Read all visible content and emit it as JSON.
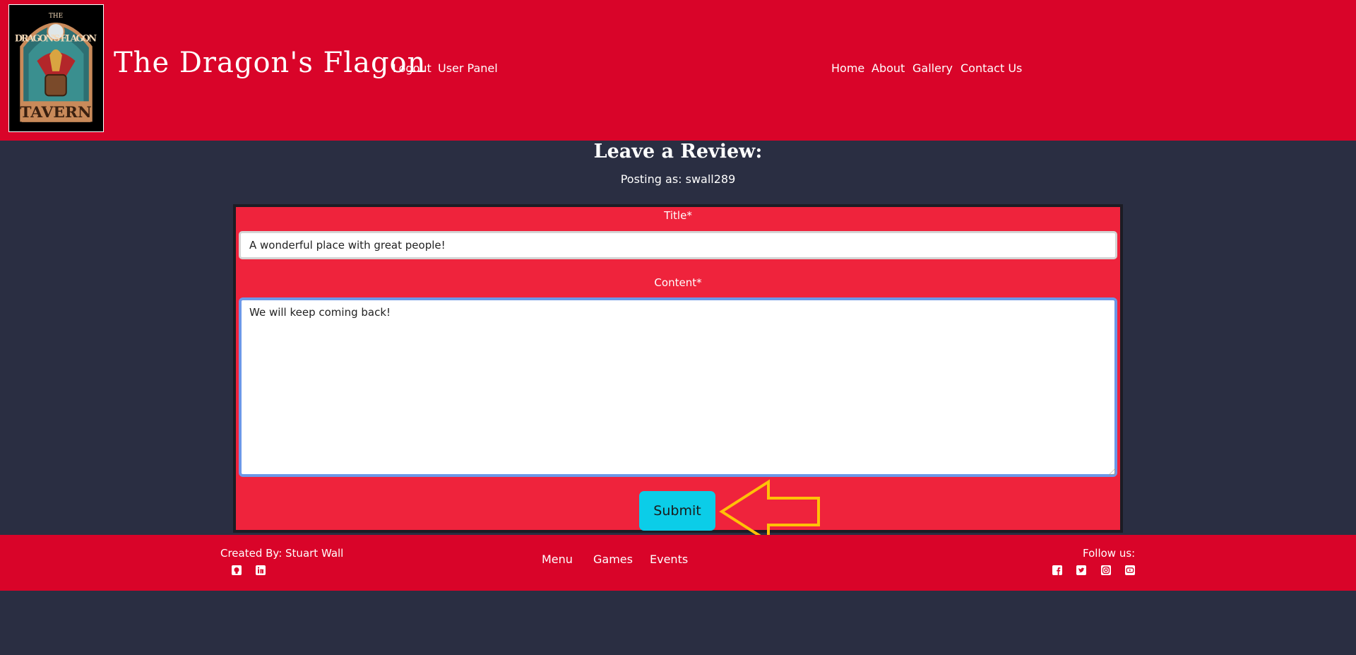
{
  "header": {
    "site_title": "The Dragon's Flagon",
    "logo": {
      "line1": "THE",
      "line2": "DRAGON'S FLAGON",
      "line3": "TAVERN"
    },
    "auth_links": [
      "Logout",
      "User Panel"
    ],
    "nav_links": [
      "Home",
      "About",
      "Gallery",
      "Contact Us"
    ]
  },
  "main": {
    "heading": "Leave a Review:",
    "posting_as": "Posting as: swall289",
    "form": {
      "title_label": "Title*",
      "title_value": "A wonderful place with great people!",
      "content_label": "Content*",
      "content_value": "We will keep coming back!",
      "submit_label": "Submit"
    }
  },
  "footer": {
    "created_by": "Created By: Stuart Wall",
    "author_icons": [
      "github-icon",
      "linkedin-icon"
    ],
    "links": [
      "Menu",
      "Games",
      "Events"
    ],
    "follow_label": "Follow us:",
    "social_icons": [
      "facebook-icon",
      "twitter-icon",
      "instagram-icon",
      "youtube-icon"
    ]
  },
  "colors": {
    "header_bg": "#d90429",
    "page_bg": "#2a2e42",
    "form_bg": "#ef233c",
    "submit_bg": "#0bcde8",
    "annotation_arrow": "#ffc107"
  }
}
